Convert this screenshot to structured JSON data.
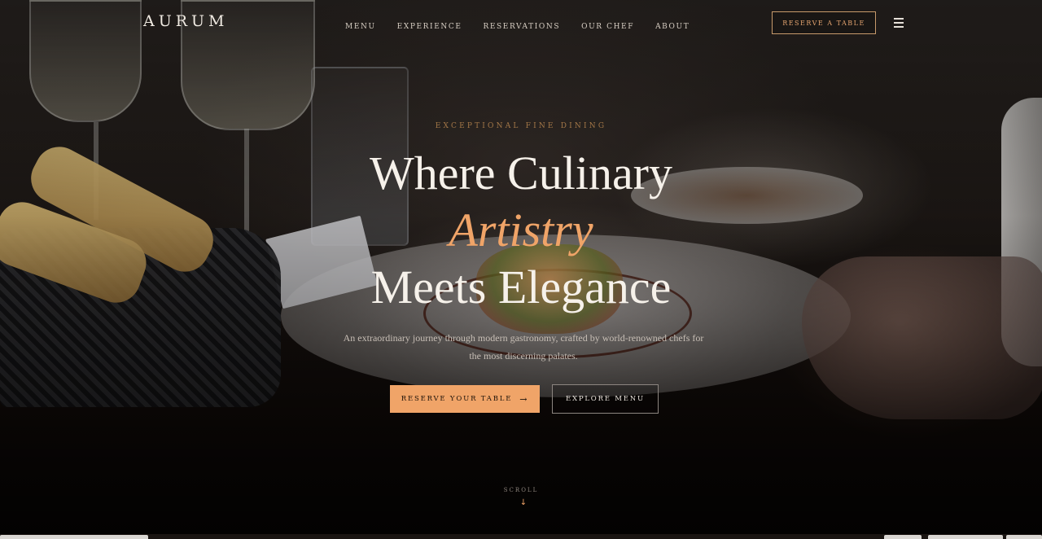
{
  "brand": {
    "name": "AURUM",
    "accent_color": "#f0a468"
  },
  "nav": {
    "items": [
      {
        "label": "MENU"
      },
      {
        "label": "EXPERIENCE"
      },
      {
        "label": "RESERVATIONS"
      },
      {
        "label": "OUR CHEF"
      },
      {
        "label": "ABOUT"
      }
    ],
    "reserve_label": "RESERVE A TABLE",
    "menu_icon": "hamburger-icon"
  },
  "hero": {
    "eyebrow": "EXCEPTIONAL FINE DINING",
    "headline_line1": "Where Culinary",
    "headline_accent": "Artistry",
    "headline_line3": "Meets Elegance",
    "subtitle": "An extraordinary journey through modern gastronomy, crafted by world-renowned chefs for the most discerning palates.",
    "primary_cta": "RESERVE YOUR TABLE",
    "primary_cta_icon": "arrow-right-icon",
    "secondary_cta": "EXPLORE MENU",
    "scroll_label": "SCROLL",
    "scroll_icon": "arrow-down-icon"
  }
}
